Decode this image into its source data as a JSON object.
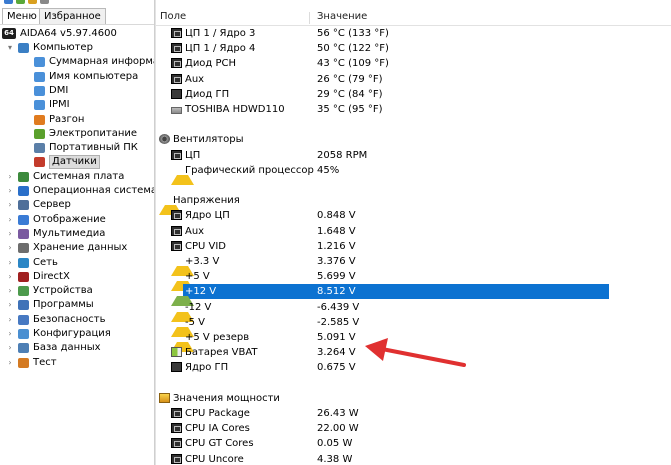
{
  "tabs": [
    "Меню",
    "Избранное"
  ],
  "app_version": "AIDA64 v5.97.4600",
  "app_badge": "64",
  "tree": [
    {
      "label": "Компьютер",
      "level": 0,
      "expander": "▾",
      "icon": "computer-icon",
      "color": "#3b7fc4"
    },
    {
      "label": "Суммарная информа",
      "level": 1,
      "icon": "summary-icon",
      "color": "#4a90d9"
    },
    {
      "label": "Имя компьютера",
      "level": 1,
      "icon": "computer-name-icon",
      "color": "#4a90d9"
    },
    {
      "label": "DMI",
      "level": 1,
      "icon": "dmi-icon",
      "color": "#4a90d9"
    },
    {
      "label": "IPMI",
      "level": 1,
      "icon": "ipmi-icon",
      "color": "#4a90d9"
    },
    {
      "label": "Разгон",
      "level": 1,
      "icon": "overclock-icon",
      "color": "#e07b1f"
    },
    {
      "label": "Электропитание",
      "level": 1,
      "icon": "power-plug-icon",
      "color": "#5aa02c"
    },
    {
      "label": "Портативный ПК",
      "level": 1,
      "icon": "laptop-icon",
      "color": "#5b7fa8"
    },
    {
      "label": "Датчики",
      "level": 1,
      "icon": "sensor-icon",
      "color": "#c33b2b",
      "selected": true
    },
    {
      "label": "Системная плата",
      "level": 0,
      "expander": "›",
      "icon": "motherboard-icon",
      "color": "#3c8a3c"
    },
    {
      "label": "Операционная система",
      "level": 0,
      "expander": "›",
      "icon": "windows-icon",
      "color": "#2a6fc9"
    },
    {
      "label": "Сервер",
      "level": 0,
      "expander": "›",
      "icon": "server-icon",
      "color": "#4f6f99"
    },
    {
      "label": "Отображение",
      "level": 0,
      "expander": "›",
      "icon": "monitor-icon",
      "color": "#3a7bd5"
    },
    {
      "label": "Мультимедиа",
      "level": 0,
      "expander": "›",
      "icon": "speaker-icon",
      "color": "#7a5aa0"
    },
    {
      "label": "Хранение данных",
      "level": 0,
      "expander": "›",
      "icon": "storage-icon",
      "color": "#6d6d6d"
    },
    {
      "label": "Сеть",
      "level": 0,
      "expander": "›",
      "icon": "network-icon",
      "color": "#2b86c5"
    },
    {
      "label": "DirectX",
      "level": 0,
      "expander": "›",
      "icon": "directx-icon",
      "color": "#a02020"
    },
    {
      "label": "Устройства",
      "level": 0,
      "expander": "›",
      "icon": "devices-icon",
      "color": "#4c9a4c"
    },
    {
      "label": "Программы",
      "level": 0,
      "expander": "›",
      "icon": "programs-icon",
      "color": "#3f72b8"
    },
    {
      "label": "Безопасность",
      "level": 0,
      "expander": "›",
      "icon": "security-icon",
      "color": "#4779c2"
    },
    {
      "label": "Конфигурация",
      "level": 0,
      "expander": "›",
      "icon": "config-icon",
      "color": "#4a8fd1"
    },
    {
      "label": "База данных",
      "level": 0,
      "expander": "›",
      "icon": "database-icon",
      "color": "#4d7fb5"
    },
    {
      "label": "Тест",
      "level": 0,
      "expander": "›",
      "icon": "test-icon",
      "color": "#d47a22"
    }
  ],
  "columns": {
    "field": "Поле",
    "value": "Значение"
  },
  "rows": [
    {
      "kind": "item",
      "icon": "chip",
      "label": "ЦП 1 / Ядро 3",
      "value": "56 °C  (133 °F)"
    },
    {
      "kind": "item",
      "icon": "chip",
      "label": "ЦП 1 / Ядро 4",
      "value": "50 °C  (122 °F)"
    },
    {
      "kind": "item",
      "icon": "chip",
      "label": "Диод PCH",
      "value": "43 °C  (109 °F)"
    },
    {
      "kind": "item",
      "icon": "chip",
      "label": "Aux",
      "value": "26 °C  (79 °F)"
    },
    {
      "kind": "item",
      "icon": "gpu",
      "label": "Диод ГП",
      "value": "29 °C  (84 °F)"
    },
    {
      "kind": "item",
      "icon": "hdd",
      "label": "TOSHIBA HDWD110",
      "value": "35 °C  (95 °F)"
    },
    {
      "kind": "blank"
    },
    {
      "kind": "section",
      "icon": "fan",
      "label": "Вентиляторы"
    },
    {
      "kind": "item",
      "icon": "chip",
      "label": "ЦП",
      "value": "2058 RPM"
    },
    {
      "kind": "item",
      "icon": "tri",
      "label": "Графический процессор",
      "value": "45%"
    },
    {
      "kind": "blank"
    },
    {
      "kind": "section",
      "icon": "tri",
      "label": "Напряжения"
    },
    {
      "kind": "item",
      "icon": "chip",
      "label": "Ядро ЦП",
      "value": "0.848 V"
    },
    {
      "kind": "item",
      "icon": "chip",
      "label": "Aux",
      "value": "1.648 V"
    },
    {
      "kind": "item",
      "icon": "chip",
      "label": "CPU VID",
      "value": "1.216 V"
    },
    {
      "kind": "item",
      "icon": "tri",
      "label": "+3.3 V",
      "value": "3.376 V"
    },
    {
      "kind": "item",
      "icon": "tri",
      "label": "+5 V",
      "value": "5.699 V"
    },
    {
      "kind": "item",
      "icon": "tri-green",
      "label": "+12 V",
      "value": "8.512 V",
      "selected": true
    },
    {
      "kind": "item",
      "icon": "tri",
      "label": "-12 V",
      "value": "-6.439 V"
    },
    {
      "kind": "item",
      "icon": "tri",
      "label": "-5 V",
      "value": "-2.585 V"
    },
    {
      "kind": "item",
      "icon": "tri",
      "label": "+5 V резерв",
      "value": "5.091 V"
    },
    {
      "kind": "item",
      "icon": "bat",
      "label": "Батарея VBAT",
      "value": "3.264 V"
    },
    {
      "kind": "item",
      "icon": "gpu",
      "label": "Ядро ГП",
      "value": "0.675 V"
    },
    {
      "kind": "blank"
    },
    {
      "kind": "section",
      "icon": "pwr",
      "label": "Значения мощности"
    },
    {
      "kind": "item",
      "icon": "chip",
      "label": "CPU Package",
      "value": "26.43 W"
    },
    {
      "kind": "item",
      "icon": "chip",
      "label": "CPU IA Cores",
      "value": "22.00 W"
    },
    {
      "kind": "item",
      "icon": "chip",
      "label": "CPU GT Cores",
      "value": "0.05 W"
    },
    {
      "kind": "item",
      "icon": "chip",
      "label": "CPU Uncore",
      "value": "4.38 W"
    }
  ],
  "colors": {
    "selection": "#0c72d1",
    "annotation_arrow": "#e03030"
  }
}
